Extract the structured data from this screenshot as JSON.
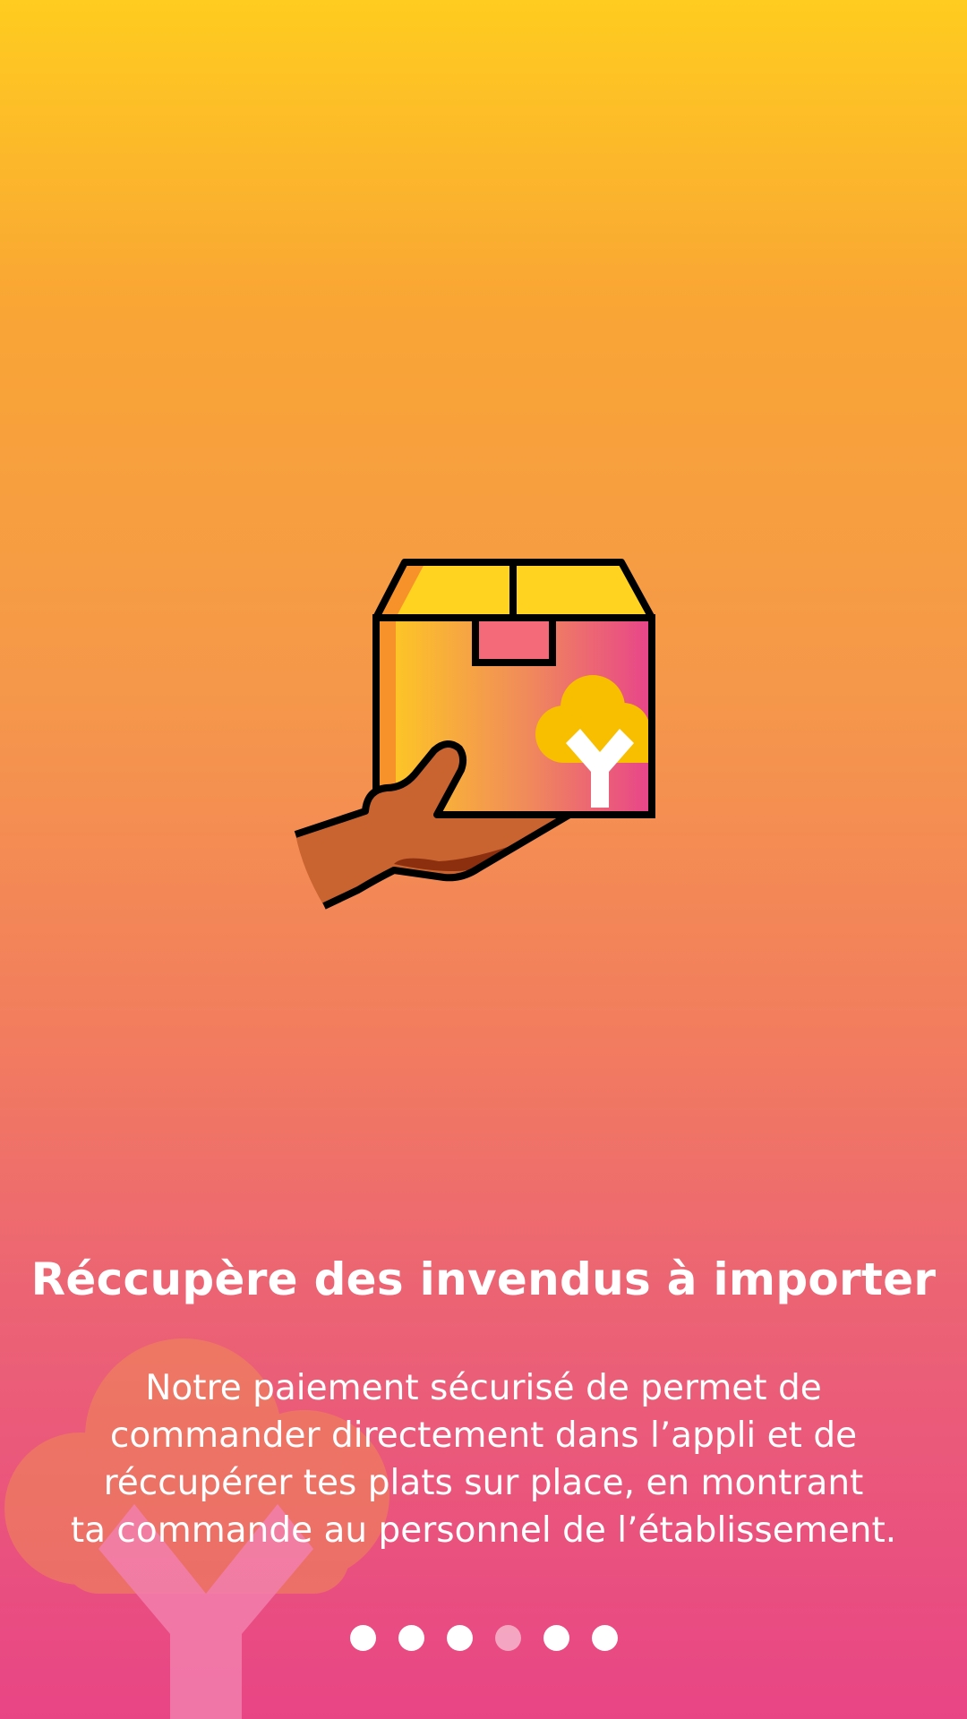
{
  "onboarding": {
    "illustration_icon": "hand-holding-package-icon",
    "background_icon": "tree-icon",
    "title": "Réccupère des invendus à importer",
    "description_lines": [
      "Notre paiement sécurisé de permet de",
      "commander directement dans l’appli et de",
      "réccupérer tes plats sur place, en montrant",
      "ta commande au personnel de l’établissement."
    ],
    "pagination": {
      "total": 6,
      "active_index": 3
    }
  },
  "colors": {
    "gradient_top": "#FFCC1F",
    "gradient_mid": "#F5984A",
    "gradient_bottom": "#E84585",
    "box_pink": "#E8448A",
    "box_yellow": "#FFD31F",
    "hand": "#C96431"
  }
}
